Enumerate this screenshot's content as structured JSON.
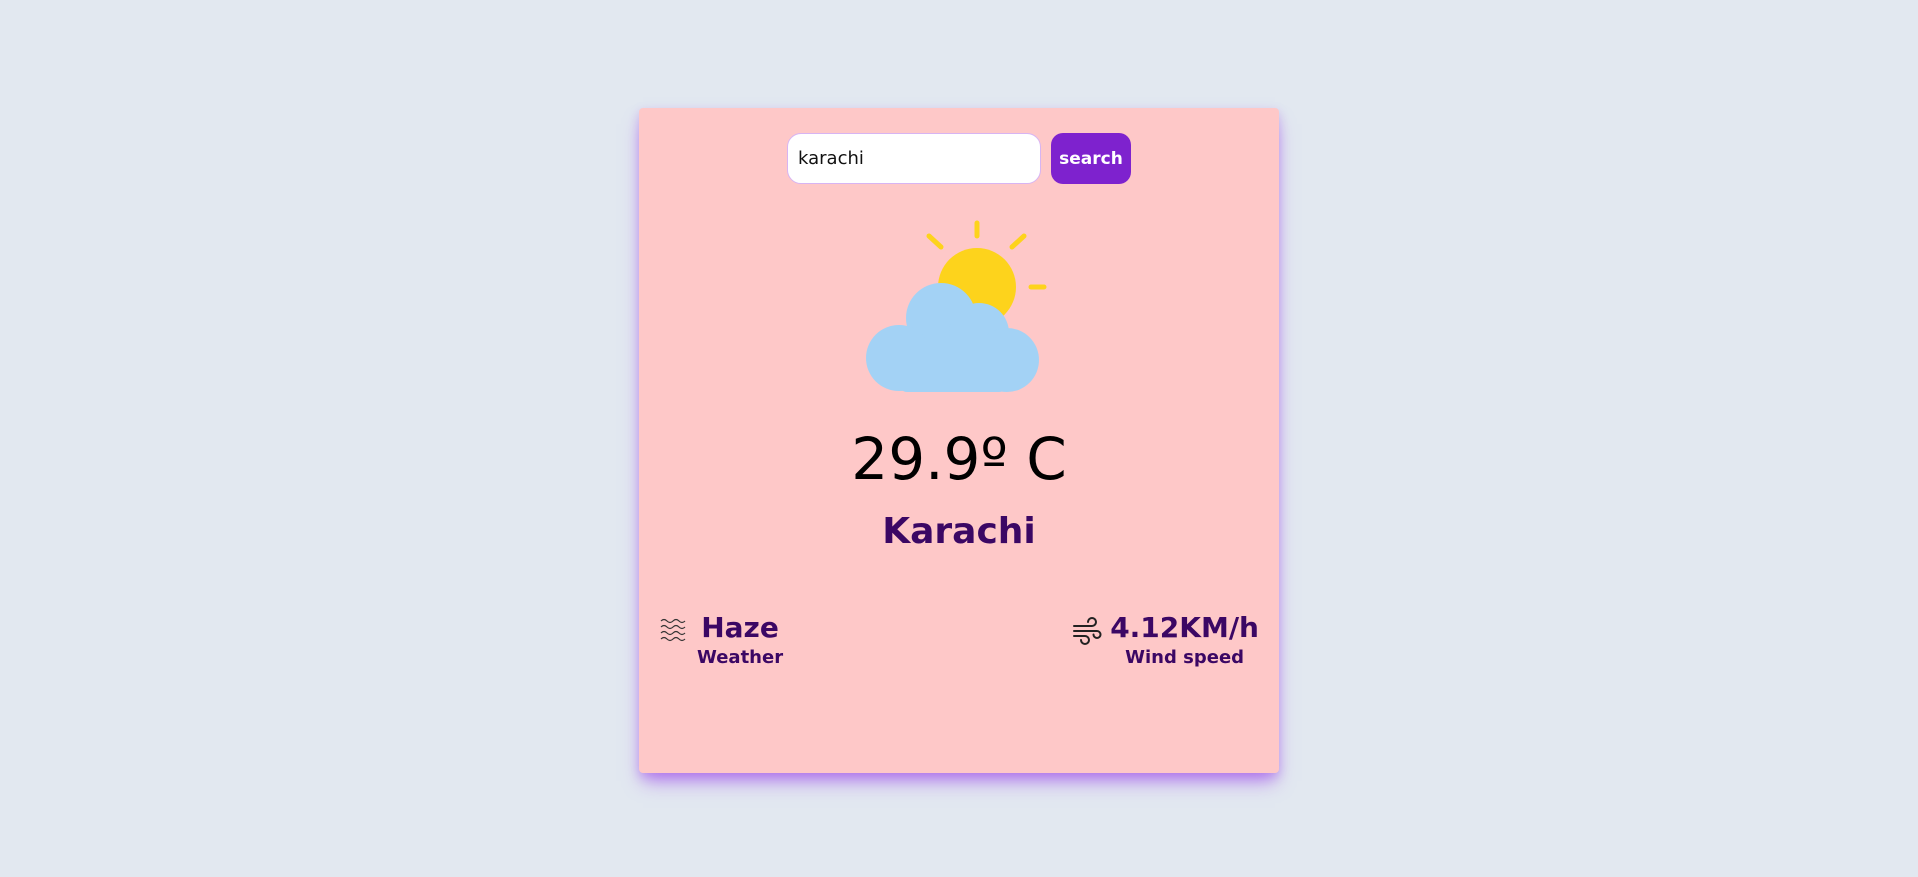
{
  "search": {
    "value": "karachi",
    "button_label": "search"
  },
  "weather": {
    "icon": "partly-cloudy-icon",
    "temperature": "29.9º C",
    "city": "Karachi",
    "condition": {
      "icon": "haze-icon",
      "value": "Haze",
      "label": "Weather"
    },
    "wind": {
      "icon": "wind-icon",
      "value": "4.12KM/h",
      "label": "Wind speed"
    }
  },
  "colors": {
    "page_bg": "#e2e8f0",
    "card_bg": "#fec8c8",
    "accent": "#7e22ce",
    "text_dark": "#3b0764",
    "sun": "#fdd31c",
    "cloud": "#a3d2f5"
  }
}
